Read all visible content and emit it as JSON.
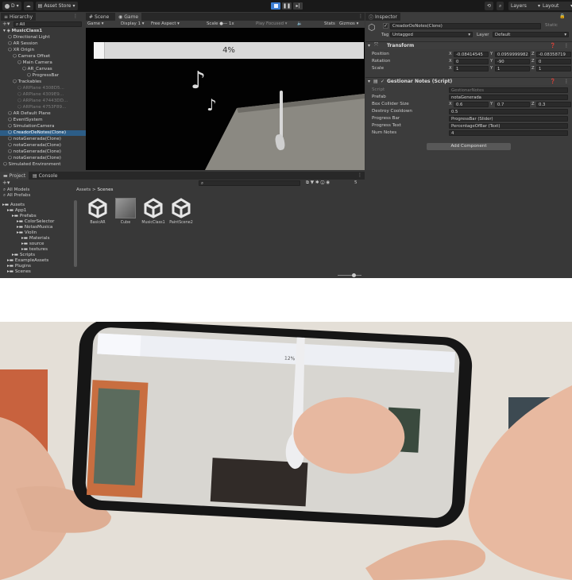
{
  "toolbar": {
    "account_label": "D",
    "asset_store_label": "Asset Store",
    "layers_label": "Layers",
    "layout_label": "Layout"
  },
  "hierarchy": {
    "tab_label": "Hierarchy",
    "search_placeholder": "All",
    "items": [
      {
        "label": "MusicClass1",
        "depth": 0,
        "style": "scene"
      },
      {
        "label": "Directional Light",
        "depth": 1,
        "style": "normal"
      },
      {
        "label": "AR Session",
        "depth": 1,
        "style": "normal"
      },
      {
        "label": "XR Origin",
        "depth": 1,
        "style": "normal"
      },
      {
        "label": "Camera Offset",
        "depth": 2,
        "style": "normal"
      },
      {
        "label": "Main Camera",
        "depth": 3,
        "style": "normal"
      },
      {
        "label": "AR_Canvas",
        "depth": 4,
        "style": "normal"
      },
      {
        "label": "ProgressBar",
        "depth": 5,
        "style": "normal"
      },
      {
        "label": "Trackables",
        "depth": 2,
        "style": "normal"
      },
      {
        "label": "ARPlane 4308D5...",
        "depth": 3,
        "style": "dim"
      },
      {
        "label": "ARPlane 4309E9...",
        "depth": 3,
        "style": "dim"
      },
      {
        "label": "ARPlane 47443DD...",
        "depth": 3,
        "style": "dim"
      },
      {
        "label": "ARPlane 4753F89...",
        "depth": 3,
        "style": "dim"
      },
      {
        "label": "AR Default Plane",
        "depth": 1,
        "style": "normal"
      },
      {
        "label": "EventSystem",
        "depth": 1,
        "style": "normal"
      },
      {
        "label": "SimulationCamera",
        "depth": 1,
        "style": "normal"
      },
      {
        "label": "CreadorDeNotes(Clone)",
        "depth": 1,
        "style": "selected"
      },
      {
        "label": "notaGenerada(Clone)",
        "depth": 1,
        "style": "normal"
      },
      {
        "label": "notaGenerada(Clone)",
        "depth": 1,
        "style": "normal"
      },
      {
        "label": "notaGenerada(Clone)",
        "depth": 1,
        "style": "normal"
      },
      {
        "label": "notaGenerada(Clone)",
        "depth": 1,
        "style": "normal"
      },
      {
        "label": "Simulated Environment",
        "depth": 0,
        "style": "normal"
      }
    ]
  },
  "scene_tabs": {
    "scene": "Scene",
    "game": "Game"
  },
  "game_bar": {
    "mode": "Game",
    "display": "Display 1",
    "aspect": "Free Aspect",
    "scale_label": "Scale",
    "scale_value": "1x",
    "play_focused": "Play Focused",
    "stats": "Stats",
    "gizmos": "Gizmos"
  },
  "game_view": {
    "progress_text": "4%",
    "progress_value": 0.04
  },
  "inspector": {
    "tab_label": "Inspector",
    "object_name": "CreadorDeNotes(Clone)",
    "static_label": "Static",
    "tag_label": "Tag",
    "tag_value": "Untagged",
    "layer_label": "Layer",
    "layer_value": "Default",
    "transform": {
      "title": "Transform",
      "rows": [
        {
          "label": "Position",
          "x": "-0.08414545",
          "y": "0.0959999982",
          "z": "-0.08358719"
        },
        {
          "label": "Rotation",
          "x": "0",
          "y": "-90",
          "z": "0"
        },
        {
          "label": "Scale",
          "x": "1",
          "y": "1",
          "z": "1"
        }
      ]
    },
    "script_component": {
      "title": "Gestionar Notes (Script)",
      "rows": [
        {
          "label": "Script",
          "value": "GestionarNotes",
          "dim": true
        },
        {
          "label": "Prefab",
          "value": "notaGenerada",
          "dim": false
        },
        {
          "label": "Box Collider Size",
          "x": "0.6",
          "y": "0.7",
          "z": "0.3"
        },
        {
          "label": "Destroy Cooldown",
          "value": "0.5",
          "dim": false
        },
        {
          "label": "Progress Bar",
          "value": "ProgressBar (Slider)",
          "dim": false
        },
        {
          "label": "Progress Text",
          "value": "PercentageOfBar (Text)",
          "dim": false
        },
        {
          "label": "Num Notes",
          "value": "4",
          "dim": false
        }
      ]
    },
    "add_component_label": "Add Component"
  },
  "project": {
    "tab_project": "Project",
    "tab_console": "Console",
    "favorites": [
      "All Models",
      "All Prefabs"
    ],
    "breadcrumb_root": "Assets",
    "breadcrumb_sep": ">",
    "breadcrumb_current": "Scenes",
    "count_label": "5",
    "tree": [
      {
        "label": "Assets",
        "depth": 0
      },
      {
        "label": "App1",
        "depth": 1
      },
      {
        "label": "Prefabs",
        "depth": 2
      },
      {
        "label": "ColorSelector",
        "depth": 3
      },
      {
        "label": "NotasMusica",
        "depth": 3
      },
      {
        "label": "Violin",
        "depth": 3
      },
      {
        "label": "Materials",
        "depth": 4
      },
      {
        "label": "source",
        "depth": 4
      },
      {
        "label": "textures",
        "depth": 4
      },
      {
        "label": "Scripts",
        "depth": 2
      },
      {
        "label": "ExampleAssets",
        "depth": 1
      },
      {
        "label": "Plugins",
        "depth": 1
      },
      {
        "label": "Scenes",
        "depth": 1
      }
    ],
    "assets": [
      {
        "label": "BasicAR",
        "kind": "unity"
      },
      {
        "label": "Cube",
        "kind": "cube"
      },
      {
        "label": "MusicClass1",
        "kind": "unity"
      },
      {
        "label": "PaintScene2",
        "kind": "unity"
      }
    ]
  },
  "phone_view": {
    "progress_text": "12%"
  },
  "colors": {
    "editor_bg": "#383838",
    "toolbar_bg": "#191919",
    "selection": "#2c5d87",
    "play_active": "#3d7fd4",
    "unity_gold": "#cfa960"
  }
}
